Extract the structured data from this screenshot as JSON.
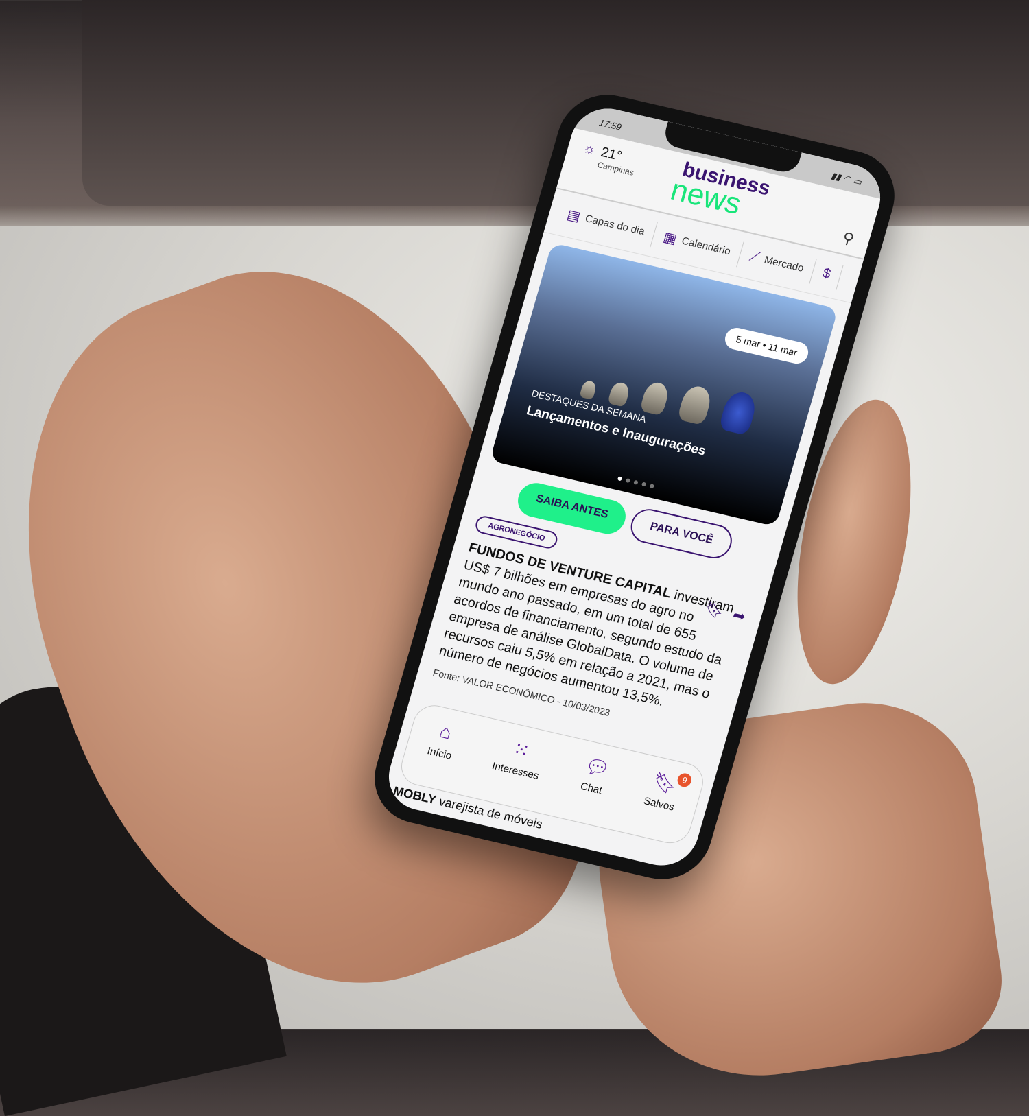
{
  "status": {
    "time": "17:59"
  },
  "header": {
    "temperature": "21°",
    "city": "Campinas",
    "logo_top": "business",
    "logo_bottom": "news"
  },
  "tabs": [
    {
      "label": "Capas do dia",
      "icon": "newspaper-icon"
    },
    {
      "label": "Calendário",
      "icon": "calendar-icon"
    },
    {
      "label": "Mercado",
      "icon": "chart-icon"
    }
  ],
  "hero": {
    "date_range": "5 mar • 11 mar",
    "kicker": "DESTAQUES DA SEMANA",
    "title": "Lançamentos e Inaugurações",
    "slide_index": 1,
    "slide_count": 5
  },
  "filters": {
    "active": "SAIBA ANTES",
    "inactive": "PARA VOCÊ"
  },
  "article": {
    "tag": "AGRONEGÓCIO",
    "lead": "FUNDOS DE VENTURE CAPITAL",
    "text": " investiram US$ 7 bilhões em empresas do agro no mundo ano passado, em um total de 655 acordos de financiamento, segundo estudo da empresa de análise GlobalData. O volume de recursos caiu 5,5% em relação a 2021, mas o número de negócios aumentou 13,5%.",
    "source": "Fonte: VALOR ECONÔMICO - 10/03/2023"
  },
  "next_article": {
    "lead": "MOBLY",
    "text": " varejista de móveis"
  },
  "bottom_nav": [
    {
      "label": "Início"
    },
    {
      "label": "Interesses"
    },
    {
      "label": "Chat"
    },
    {
      "label": "Salvos",
      "badge": "9"
    }
  ],
  "colors": {
    "brand_purple": "#3a1470",
    "brand_green": "#19e57a",
    "badge": "#e8542c"
  }
}
